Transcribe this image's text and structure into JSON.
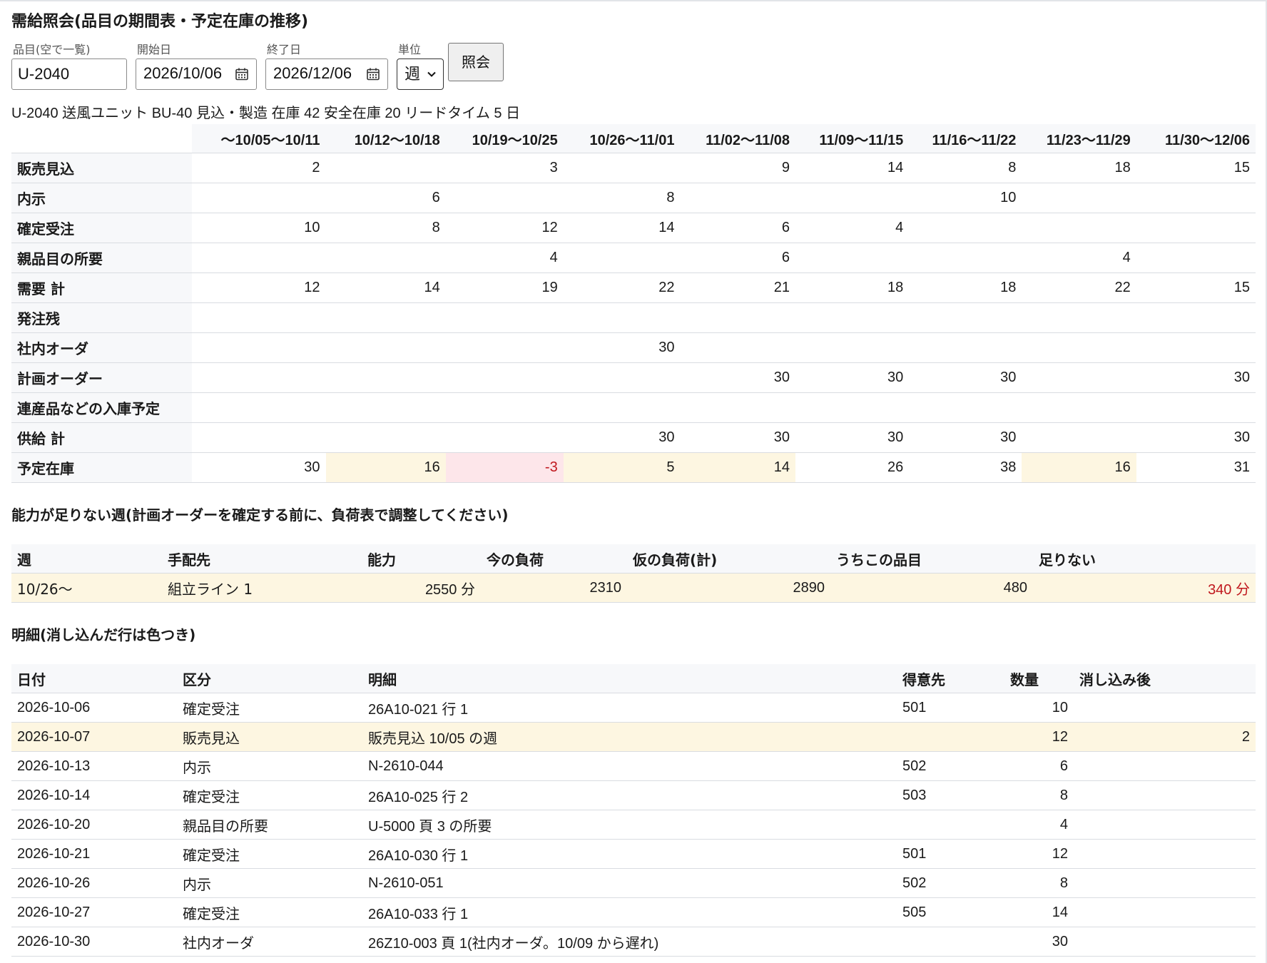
{
  "title": "需給照会(品目の期間表・予定在庫の推移)",
  "filters": {
    "item_label": "品目(空で一覧)",
    "item_value": "U-2040",
    "start_label": "開始日",
    "start_value": "2026/10/06",
    "end_label": "終了日",
    "end_value": "2026/12/06",
    "unit_label": "単位",
    "unit_value": "週",
    "submit_label": "照会"
  },
  "summary": "U-2040 送風ユニット BU-40 見込・製造 在庫 42 安全在庫 20 リードタイム 5 日",
  "period_table": {
    "periods": [
      "〜10/05〜10/11",
      "10/12〜10/18",
      "10/19〜10/25",
      "10/26〜11/01",
      "11/02〜11/08",
      "11/09〜11/15",
      "11/16〜11/22",
      "11/23〜11/29",
      "11/30〜12/06"
    ],
    "rows": [
      {
        "label": "販売見込",
        "values": [
          "2",
          "",
          "3",
          "",
          "9",
          "14",
          "8",
          "18",
          "15"
        ]
      },
      {
        "label": "内示",
        "values": [
          "",
          "6",
          "",
          "8",
          "",
          "",
          "10",
          "",
          ""
        ]
      },
      {
        "label": "確定受注",
        "values": [
          "10",
          "8",
          "12",
          "14",
          "6",
          "4",
          "",
          "",
          ""
        ]
      },
      {
        "label": "親品目の所要",
        "values": [
          "",
          "",
          "4",
          "",
          "6",
          "",
          "",
          "4",
          ""
        ]
      },
      {
        "label": "需要 計",
        "values": [
          "12",
          "14",
          "19",
          "22",
          "21",
          "18",
          "18",
          "22",
          "15"
        ]
      },
      {
        "label": "発注残",
        "values": [
          "",
          "",
          "",
          "",
          "",
          "",
          "",
          "",
          ""
        ]
      },
      {
        "label": "社内オーダ",
        "values": [
          "",
          "",
          "",
          "30",
          "",
          "",
          "",
          "",
          ""
        ]
      },
      {
        "label": "計画オーダー",
        "values": [
          "",
          "",
          "",
          "",
          "30",
          "30",
          "30",
          "",
          "30"
        ]
      },
      {
        "label": "連産品などの入庫予定",
        "values": [
          "",
          "",
          "",
          "",
          "",
          "",
          "",
          "",
          ""
        ]
      },
      {
        "label": "供給 計",
        "values": [
          "",
          "",
          "",
          "30",
          "30",
          "30",
          "30",
          "",
          "30"
        ]
      },
      {
        "label": "予定在庫",
        "values": [
          "30",
          "16",
          "-3",
          "5",
          "14",
          "26",
          "38",
          "16",
          "31"
        ],
        "status": [
          "",
          "warn",
          "neg",
          "warn",
          "warn",
          "",
          "",
          "warn",
          ""
        ]
      }
    ],
    "colors": {
      "warn_bg": "#fdf6e1",
      "neg_bg": "#fde6ea",
      "neg_text": "#c0181e"
    }
  },
  "capacity": {
    "title": "能力が足りない週(計画オーダーを確定する前に、負荷表で調整してください)",
    "headers": [
      "週",
      "手配先",
      "能力",
      "今の負荷",
      "仮の負荷(計)",
      "うちこの品目",
      "足りない"
    ],
    "rows": [
      [
        "10/26〜",
        "組立ライン 1",
        "2550 分",
        "2310",
        "2890",
        "480",
        "340 分"
      ]
    ]
  },
  "detail": {
    "title": "明細(消し込んだ行は色つき)",
    "headers": [
      "日付",
      "区分",
      "明細",
      "得意先",
      "数量",
      "消し込み後"
    ],
    "rows": [
      {
        "cells": [
          "2026-10-06",
          "確定受注",
          "26A10-021 行 1",
          "501",
          "10",
          ""
        ]
      },
      {
        "cells": [
          "2026-10-07",
          "販売見込",
          "販売見込 10/05 の週",
          "",
          "12",
          "2"
        ],
        "highlight": true
      },
      {
        "cells": [
          "2026-10-13",
          "内示",
          "N-2610-044",
          "502",
          "6",
          ""
        ]
      },
      {
        "cells": [
          "2026-10-14",
          "確定受注",
          "26A10-025 行 2",
          "503",
          "8",
          ""
        ]
      },
      {
        "cells": [
          "2026-10-20",
          "親品目の所要",
          "U-5000 頁 3 の所要",
          "",
          "4",
          ""
        ]
      },
      {
        "cells": [
          "2026-10-21",
          "確定受注",
          "26A10-030 行 1",
          "501",
          "12",
          ""
        ]
      },
      {
        "cells": [
          "2026-10-26",
          "内示",
          "N-2610-051",
          "502",
          "8",
          ""
        ]
      },
      {
        "cells": [
          "2026-10-27",
          "確定受注",
          "26A10-033 行 1",
          "505",
          "14",
          ""
        ]
      },
      {
        "cells": [
          "2026-10-30",
          "社内オーダ",
          "26Z10-003 頁 1(社内オーダ。10/09 から遅れ)",
          "",
          "30",
          ""
        ]
      }
    ]
  }
}
